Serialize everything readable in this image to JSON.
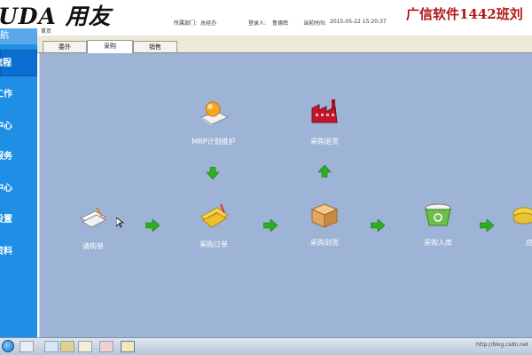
{
  "header": {
    "logo": "UDA 用友",
    "dept_label": "所属部门:",
    "dept_value": "总经办",
    "user_label": "登录人:",
    "user_value": "鲁德辉",
    "time_label": "当前时间:",
    "time_value": "2015-05-22 15:20:37",
    "brand": "广信软件1442班刘"
  },
  "nav": {
    "title": "导航",
    "items": [
      {
        "label": "流程"
      },
      {
        "label": "工作"
      },
      {
        "label": "中心"
      },
      {
        "label": "服务"
      },
      {
        "label": "中心"
      },
      {
        "label": "设置"
      },
      {
        "label": "资料"
      }
    ]
  },
  "main": {
    "breadcrumb": "首页",
    "tabs": [
      {
        "label": "委外"
      },
      {
        "label": "采购"
      },
      {
        "label": "销售"
      }
    ],
    "nodes": {
      "mrp": "MRP计划维护",
      "return": "采购退货",
      "request": "请购单",
      "order": "采购订单",
      "arrival": "采购到货",
      "inbound": "采购入库",
      "partial": "应"
    }
  },
  "colors": {
    "canvas": "#9db4d6",
    "nav": "#1e8fe5",
    "brand": "#b21818",
    "arrow": "#2fae1e"
  },
  "taskbar": {
    "tray_text": "http://blog.csdn.net"
  }
}
